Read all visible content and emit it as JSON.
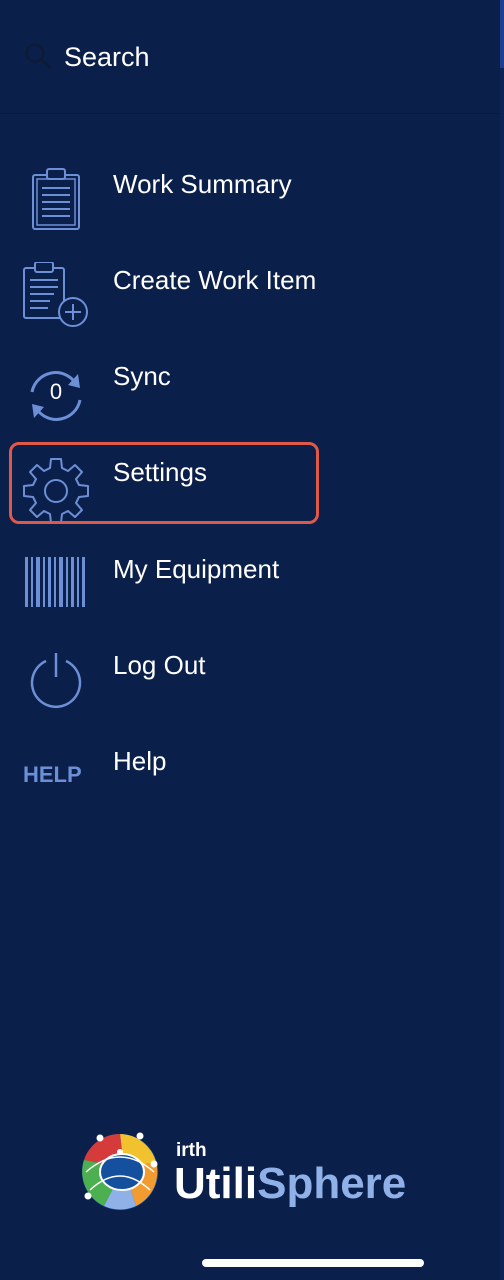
{
  "search": {
    "label": "Search",
    "icon": "search-icon"
  },
  "menu": {
    "items": [
      {
        "label": "Work Summary",
        "icon": "clipboard-icon"
      },
      {
        "label": "Create Work Item",
        "icon": "clipboard-add-icon"
      },
      {
        "label": "Sync",
        "icon": "sync-icon",
        "badge": "0"
      },
      {
        "label": "Settings",
        "icon": "gear-icon",
        "highlighted": true
      },
      {
        "label": "My Equipment",
        "icon": "barcode-icon"
      },
      {
        "label": "Log Out",
        "icon": "power-icon"
      },
      {
        "label": "Help",
        "icon": "help-icon",
        "icon_text": "HELP"
      }
    ]
  },
  "logo": {
    "small": "irth",
    "big_part1": "Utili",
    "big_part2": "Sphere"
  },
  "colors": {
    "background": "#0b1f4b",
    "icon": "#6d8fd6",
    "highlight": "#e05848",
    "logo_accent": "#8fb1e8"
  }
}
